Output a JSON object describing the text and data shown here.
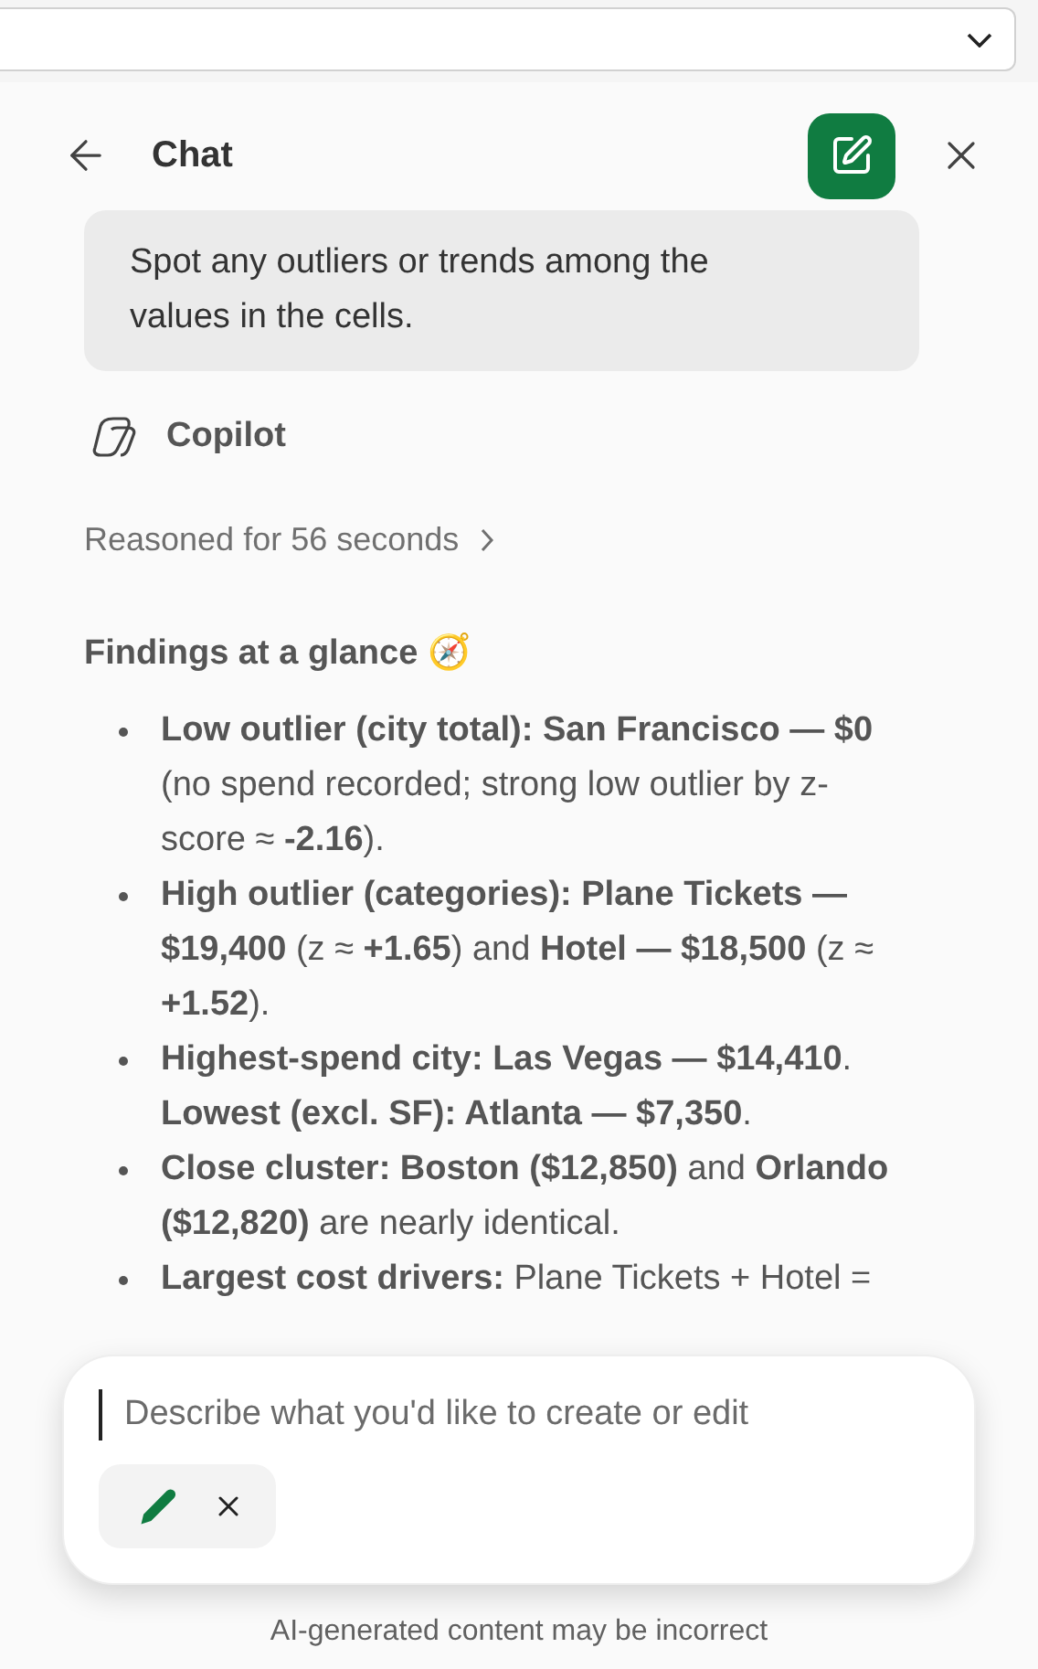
{
  "header": {
    "title": "Chat"
  },
  "user_message": "Spot any outliers or trends among the values in the cells.",
  "assistant": {
    "name": "Copilot",
    "reasoning": "Reasoned for 56 seconds",
    "heading": "Findings at a glance 🧭",
    "bullets": [
      "**Low outlier (city total): San Francisco — $0** (no spend recorded; strong low outlier by z-score ≈ **-2.16**).",
      "**High outlier (categories): Plane Tickets — $19,400** (z ≈ **+1.65**) and **Hotel — $18,500** (z ≈ **+1.52**).",
      "**Highest-spend city: Las Vegas — $14,410**. **Lowest (excl. SF): Atlanta — $7,350**.",
      "**Close cluster: Boston ($12,850)** and **Orlando ($12,820)** are nearly identical.",
      "**Largest cost drivers:** Plane Tickets + Hotel ="
    ]
  },
  "composer": {
    "placeholder": "Describe what you'd like to create or edit"
  },
  "footer": "AI-generated content may be incorrect"
}
